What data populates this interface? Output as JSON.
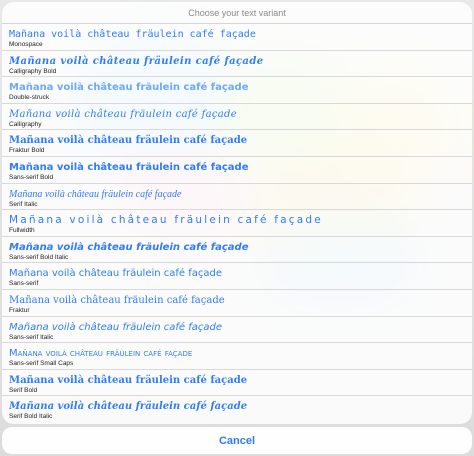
{
  "sheet": {
    "title": "Choose your text variant",
    "items": [
      {
        "sample": "Mañana voilà château fräulein café façade",
        "style": "Monospace"
      },
      {
        "sample": "Mañana voilà château fräulein café façade",
        "style": "Calligraphy Bold"
      },
      {
        "sample": "Mañana voilà château fräulein café façade",
        "style": "Double-struck"
      },
      {
        "sample": "Mañana voilà château fräulein café façade",
        "style": "Calligraphy"
      },
      {
        "sample": "Mañana voilà château fräulein café façade",
        "style": "Fraktur Bold"
      },
      {
        "sample": "Mañana voilà château fräulein café façade",
        "style": "Sans-serif Bold"
      },
      {
        "sample": "Mañana voilà château fräulein café façade",
        "style": "Serif Italic"
      },
      {
        "sample": "Mañana voilà château fräulein café façade",
        "style": "Fullwidth"
      },
      {
        "sample": "Mañana voilà château fräulein café façade",
        "style": "Sans-serif Bold Italic"
      },
      {
        "sample": "Mañana voilà château fräulein café façade",
        "style": "Sans-serif"
      },
      {
        "sample": "Mañana voilà château fräulein café façade",
        "style": "Fraktur"
      },
      {
        "sample": "Mañana voilà château fräulein café façade",
        "style": "Sans-serif Italic"
      },
      {
        "sample": "Mañana voilà château fräulein café façade",
        "style": "Sans-serif Small Caps"
      },
      {
        "sample": "Mañana voilà château fräulein café façade",
        "style": "Serif Bold"
      },
      {
        "sample": "Mañana voilà château fräulein café façade",
        "style": "Serif Bold Italic"
      }
    ]
  },
  "cancel_label": "Cancel",
  "colors": {
    "accent": "#2f7cf6",
    "label": "#222222",
    "title": "#8a8a8e"
  }
}
